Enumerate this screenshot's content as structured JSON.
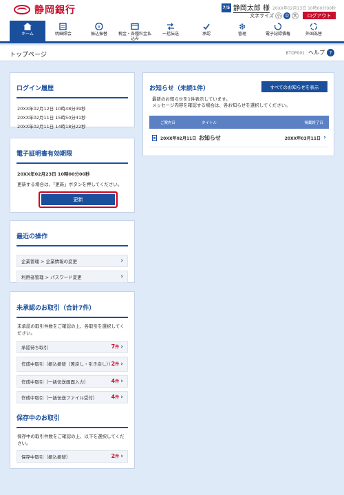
{
  "header": {
    "bank_name": "静岡銀行",
    "user_badge": "7/5",
    "user_name": "静岡太郎 様",
    "last_login": "20XX年02月13日 10時00分00秒",
    "text_size_label": "文字サイズ",
    "text_size_small": "小",
    "text_size_medium": "中",
    "text_size_large": "大",
    "logout_label": "ログアウト"
  },
  "nav": {
    "items": [
      {
        "label": "ホーム",
        "icon": "home-icon"
      },
      {
        "label": "明細照会",
        "icon": "statement-icon"
      },
      {
        "label": "振込振替",
        "icon": "transfer-icon"
      },
      {
        "label": "税金・各種料金払込み",
        "icon": "tax-payment-icon"
      },
      {
        "label": "一括伝送",
        "icon": "batch-transfer-icon"
      },
      {
        "label": "承認",
        "icon": "approval-icon"
      },
      {
        "label": "管理",
        "icon": "settings-icon"
      },
      {
        "label": "電子記録債権",
        "icon": "e-bond-icon"
      },
      {
        "label": "外国為替",
        "icon": "forex-icon"
      }
    ]
  },
  "page": {
    "title": "トップページ",
    "screen_id": "BTOP001",
    "help_label": "ヘルプ",
    "help_icon_text": "?"
  },
  "login_history": {
    "title": "ログイン履歴",
    "entries": [
      "20XX年02月12日 10時48分39秒",
      "20XX年02月11日 15時50分41秒",
      "20XX年02月11日 14時18分22秒"
    ]
  },
  "certificate": {
    "title": "電子証明書有効期限",
    "expiry": "20XX年02月23日 10時00分00秒",
    "note": "更新する場合は、「更新」ボタンを押してください。",
    "update_label": "更新"
  },
  "recent_ops": {
    "title": "最近の操作",
    "items": [
      "企業管理 > 企業情報の変更",
      "利用者管理 > パスワード変更"
    ]
  },
  "pending": {
    "title": "未承認のお取引（合計7件）",
    "desc": "未承認の取引件数をご確認の上、各取引を選択してください。",
    "items": [
      {
        "label": "承認待ち取引",
        "count": "7",
        "unit": "件"
      },
      {
        "label": "作成中取引（振込振替（差戻し・引き戻し））",
        "count": "2",
        "unit": "件"
      },
      {
        "label": "作成中取引（一括伝送画面入力）",
        "count": "4",
        "unit": "件"
      },
      {
        "label": "作成中取引（一括伝送ファイル受付）",
        "count": "4",
        "unit": "件"
      }
    ],
    "saved_title": "保存中のお取引",
    "saved_desc": "保存中の取引件数をご確認の上、以下を選択してください。",
    "saved_items": [
      {
        "label": "保存中取引（振込振替）",
        "count": "2",
        "unit": "件"
      }
    ]
  },
  "news": {
    "title": "お知らせ（未読1件）",
    "all_label": "すべてのお知らせを表示",
    "desc_line1": "最新のお知らせを1件表示しています。",
    "desc_line2": "メッセージ内容を確認する場合は、各お知らせを選択してください。",
    "col_date": "ご案内日",
    "col_title": "タイトル",
    "col_end": "掲載終了日",
    "rows": [
      {
        "date": "20XX年02月11日",
        "title": "お知らせ",
        "end": "20XX年03月11日"
      }
    ]
  }
}
